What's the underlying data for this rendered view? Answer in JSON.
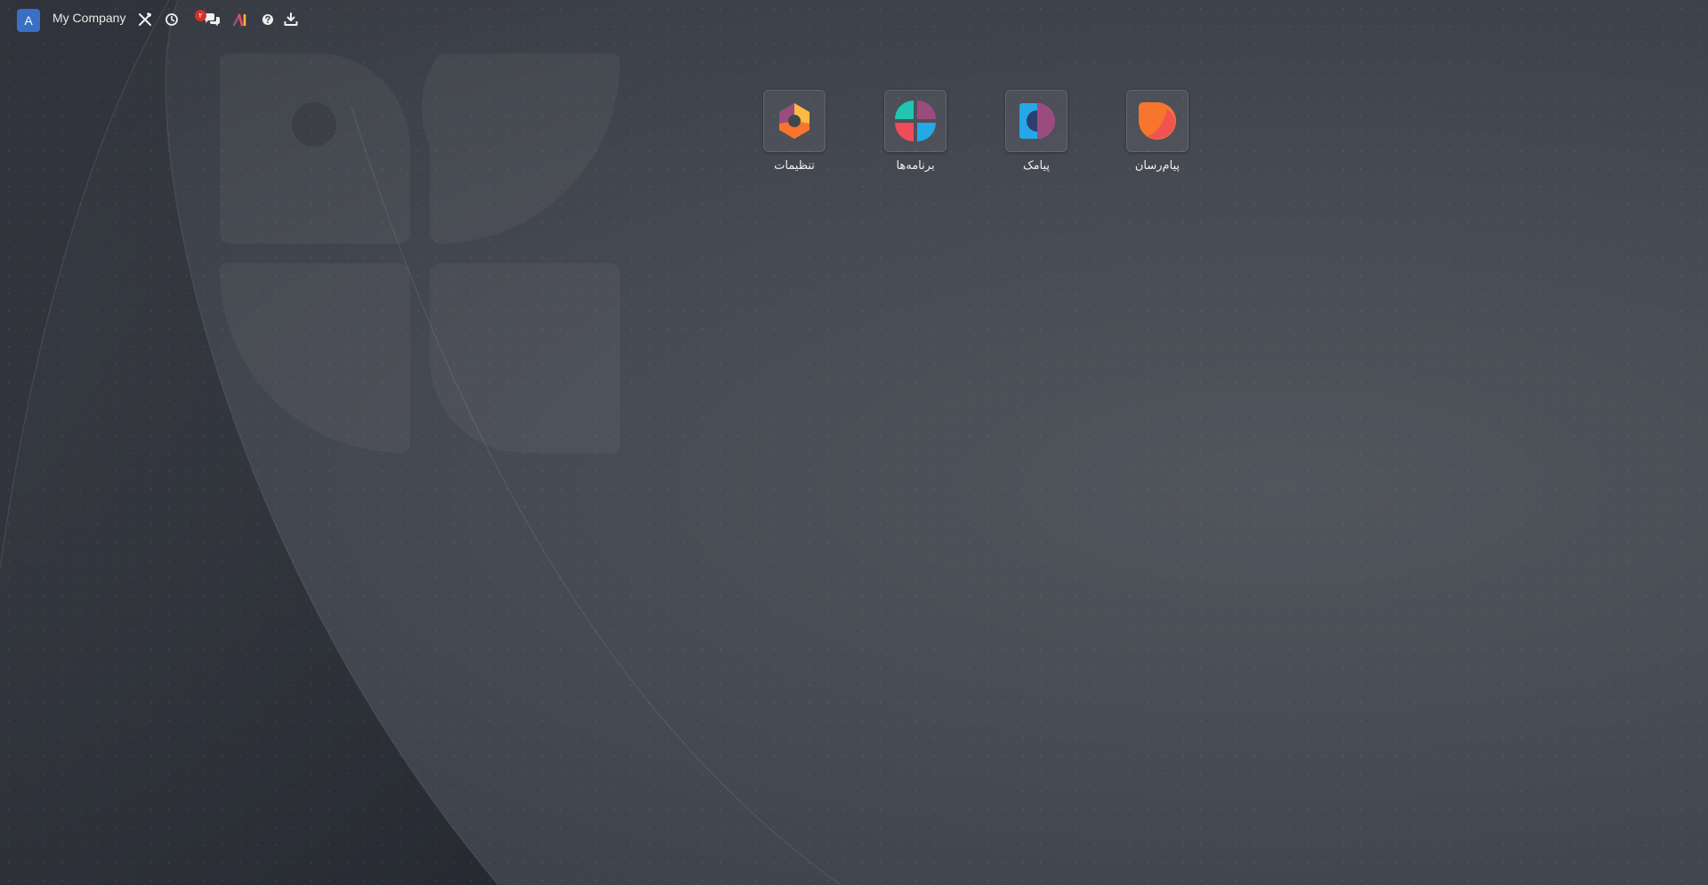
{
  "header": {
    "avatar_letter": "A",
    "company_name": "My Company",
    "icons": [
      "tools-icon",
      "clock-icon",
      "chat-icon",
      "brand-logo-icon",
      "help-icon",
      "download-icon"
    ],
    "messages_badge": "۲"
  },
  "apps": [
    {
      "label": "پیام‌رسان",
      "icon": "discuss-app-icon"
    },
    {
      "label": "پیامک",
      "icon": "sms-app-icon"
    },
    {
      "label": "برنامه‌ها",
      "icon": "apps-app-icon"
    },
    {
      "label": "تنظیمات",
      "icon": "settings-app-icon"
    }
  ],
  "colors": {
    "avatar": "#3a6fc4",
    "badge": "#d2302c",
    "orange": "#f7752d",
    "teal": "#22c5b1",
    "purple": "#9a4c7e",
    "red": "#f04c59",
    "blue": "#26a7e8",
    "yellow": "#fbb945"
  }
}
